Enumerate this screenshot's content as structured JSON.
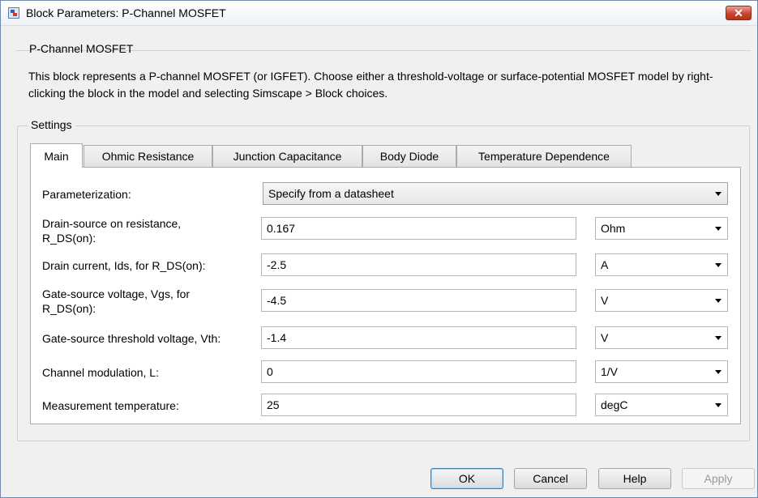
{
  "window": {
    "title": "Block Parameters: P-Channel MOSFET",
    "close_label": "✕"
  },
  "description": {
    "heading": "P-Channel MOSFET",
    "text": "This block represents a P-channel MOSFET (or IGFET). Choose either a threshold-voltage or surface-potential MOSFET model by right-clicking the block in the model and selecting Simscape > Block choices."
  },
  "settings": {
    "heading": "Settings",
    "tabs": [
      {
        "label": "Main",
        "active": true
      },
      {
        "label": "Ohmic Resistance"
      },
      {
        "label": "Junction Capacitance"
      },
      {
        "label": "Body Diode"
      },
      {
        "label": "Temperature Dependence"
      }
    ],
    "parameterization": {
      "label": "Parameterization:",
      "value": "Specify from a datasheet"
    },
    "params": [
      {
        "label": "Drain-source on resistance,\nR_DS(on):",
        "value": "0.167",
        "unit": "Ohm"
      },
      {
        "label": "Drain current, Ids, for R_DS(on):",
        "value": "-2.5",
        "unit": "A"
      },
      {
        "label": "Gate-source voltage, Vgs, for\nR_DS(on):",
        "value": "-4.5",
        "unit": "V"
      },
      {
        "label": "Gate-source threshold voltage, Vth:",
        "value": "-1.4",
        "unit": "V"
      },
      {
        "label": "Channel modulation, L:",
        "value": "0",
        "unit": "1/V"
      },
      {
        "label": "Measurement temperature:",
        "value": "25",
        "unit": "degC"
      }
    ]
  },
  "buttons": {
    "ok": "OK",
    "cancel": "Cancel",
    "help": "Help",
    "apply": "Apply"
  }
}
